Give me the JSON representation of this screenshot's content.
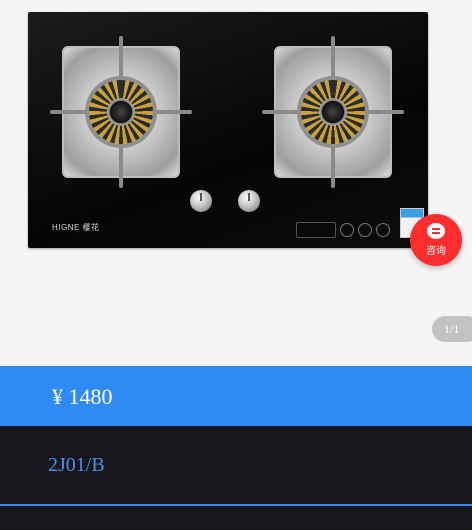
{
  "product": {
    "brand_text": "HIGNE 樱花",
    "price": "¥ 1480",
    "model": "2J01/B"
  },
  "consult": {
    "label": "咨询",
    "icon": "chat-bubble-icon"
  },
  "gallery": {
    "page_indicator": "1/1"
  },
  "colors": {
    "price_bar": "#2f8af5",
    "model_bar": "#15171c",
    "model_text": "#4c8fe9",
    "consult_button": "#ff2d2d"
  }
}
